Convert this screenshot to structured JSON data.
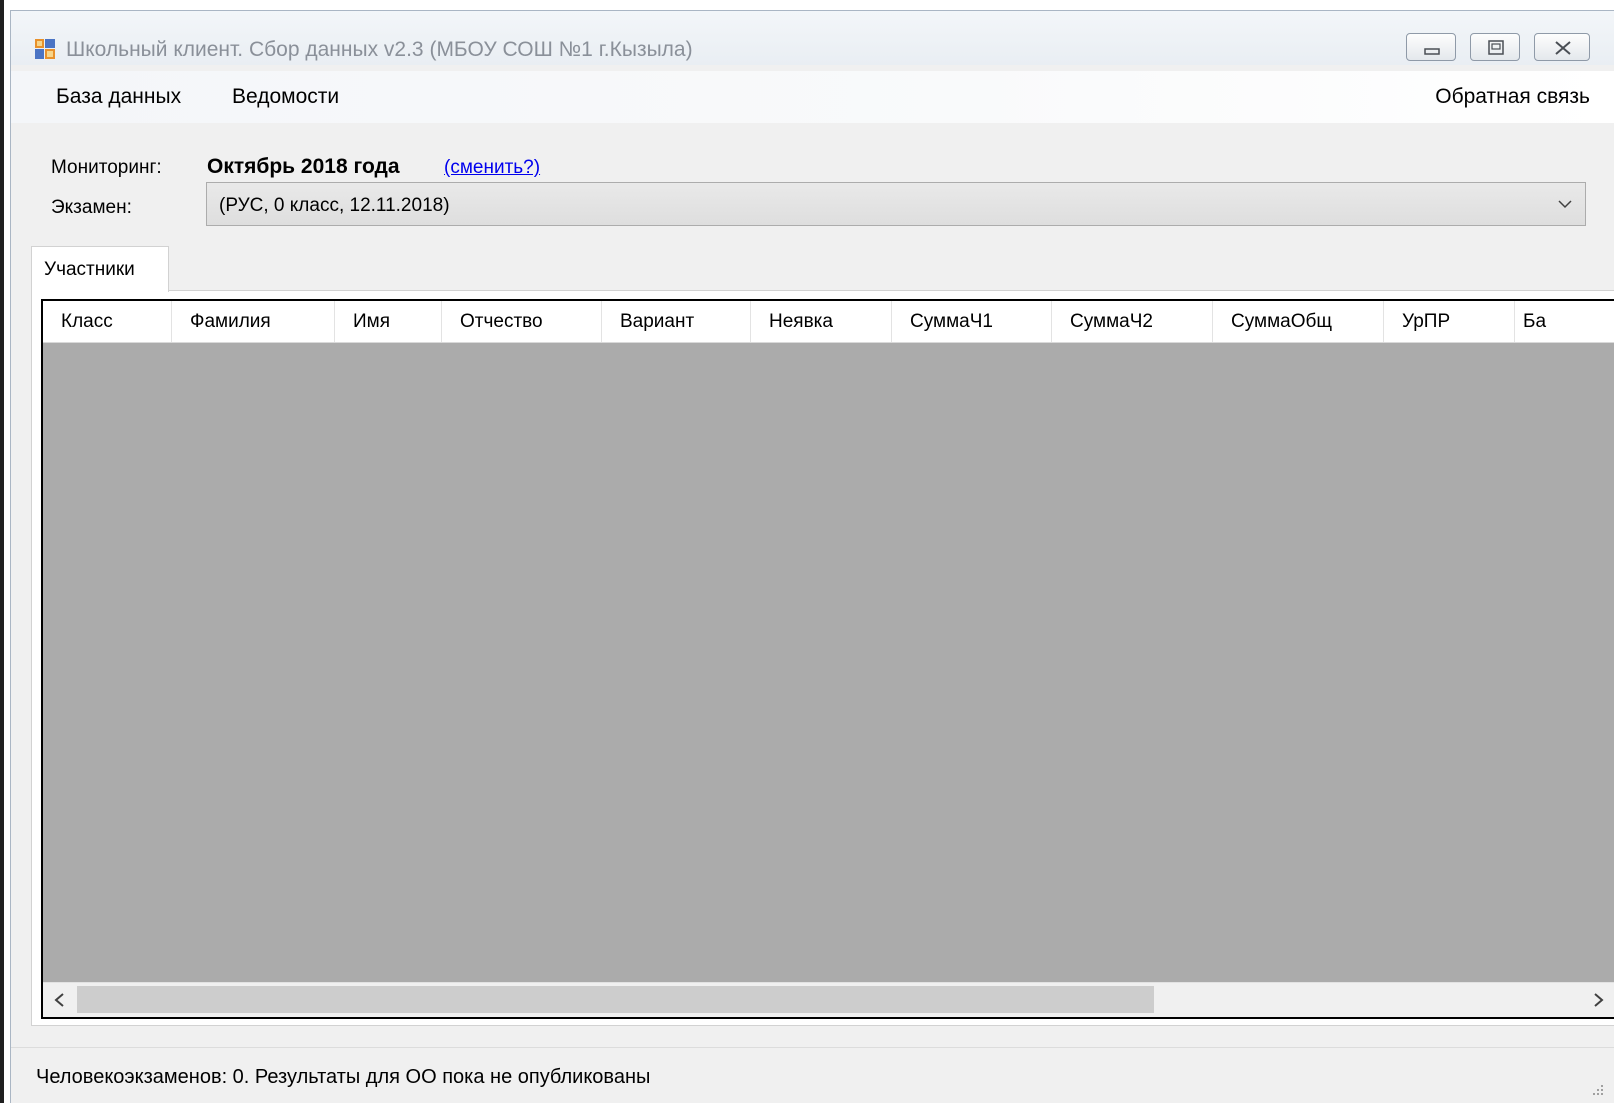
{
  "window": {
    "title": "Школьный клиент. Сбор данных v2.3 (МБОУ СОШ №1 г.Кызыла)",
    "icon": "app-window-icon"
  },
  "menu": {
    "items": [
      "База данных",
      "Ведомости"
    ],
    "feedback": "Обратная связь"
  },
  "monitoring": {
    "label": "Мониторинг:",
    "value": "Октябрь 2018 года",
    "change_link": "(сменить?)"
  },
  "exam": {
    "label": "Экзамен:",
    "selected": "(РУС, 0 класс, 12.11.2018)"
  },
  "tabs": [
    {
      "label": "Участники",
      "active": true
    }
  ],
  "grid": {
    "columns": [
      "Класс",
      "Фамилия",
      "Имя",
      "Отчество",
      "Вариант",
      "Неявка",
      "СуммаЧ1",
      "СуммаЧ2",
      "СуммаОбщ",
      "УрПР",
      "Ба"
    ],
    "rows": []
  },
  "status": {
    "text": "Человекоэкзаменов: 0. Результаты для ОО пока не опубликованы"
  },
  "colors": {
    "grid_background": "#ababab",
    "link": "#0000ee",
    "title_text": "#8a9099",
    "window_background": "#f0f0f0"
  }
}
